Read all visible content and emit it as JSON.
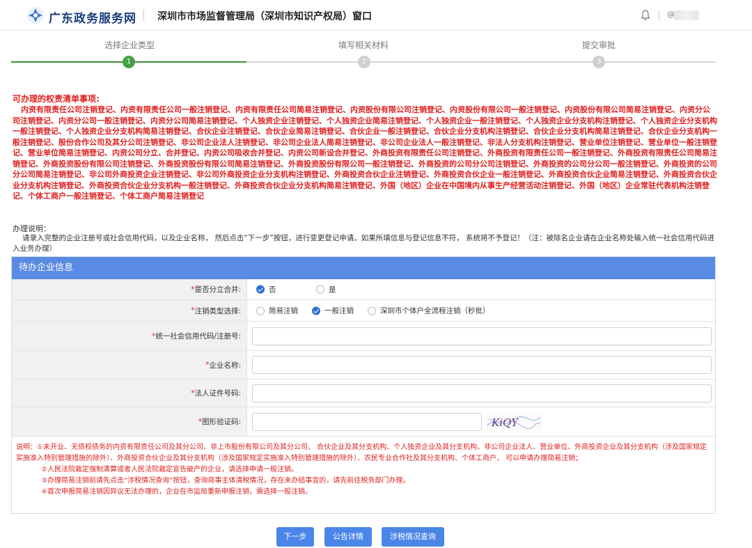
{
  "header": {
    "site_name": "广东政务服务网",
    "window_title": "深圳市市场监督管理局（深圳市知识产权局）窗口",
    "user_icon": "@"
  },
  "steps": [
    {
      "label": "选择企业类型",
      "number": "1",
      "active": true
    },
    {
      "label": "填写相关材料",
      "number": "2",
      "active": false
    },
    {
      "label": "提交审批",
      "number": "3",
      "active": false
    }
  ],
  "rights": {
    "title": "可办理的权责清单事项:",
    "text": "内资有限责任公司注销登记、内资有限责任公司一般注销登记、内资有限责任公司简易注销登记、内资股份有限公司注销登记、内资股份有限公司一般注销登记、内资股份有限公司简易注销登记、内资分公司注销登记、内资分公司一般注销登记、内资分公司简易注销登记、个人独资企业注销登记、个人独资企业简易注销登记、个人独资企业一般注销登记、个人独资企业分支机构注销登记、个人独资企业分支机构一般注销登记、个人独资企业分支机构简易注销登记、合伙企业注销登记、合伙企业简易注销登记、合伙企业一般注销登记、合伙企业分支机构注销登记、合伙企业分支机构简易注销登记、合伙企业分支机构一般注销登记、股份合作公司及其分公司注销登记、非公司企业法人注销登记、非公司企业法人简易注销登记、非公司企业法人一般注销登记、非法人分支机构注销登记、营业单位注销登记、营业单位一般注销登记、营业单位简易注销登记、内资公司分立、合并登记、内资公司吸收合并登记、内资公司新设合并登记、外商投资有限责任公司注销登记、外商投资有限责任公司一般注销登记、外商投资有限责任公司简易注销登记、外商投资股份有限公司注销登记、外商投资股份有限公司简易注销登记、外商投资股份有限公司一般注销登记、外商投资的公司分公司注销登记、外商投资的公司分公司一般注销登记、外商投资的公司分公司简易注销登记、非公司外商投资企业注销登记、非公司外商投资企业分支机构注销登记、外商投资合伙企业注销登记、外商投资合伙企业一般注销登记、外商投资合伙企业简易注销登记、外商投资合伙企业分支机构注销登记、外商投资合伙企业分支机构一般注销登记、外商投资合伙企业分支机构简易注销登记、外国（地区）企业在中国境内从事生产经营活动注销登记、外国（地区）企业常驻代表机构注销登记、个体工商户一般注销登记、个体工商户简易注销登记"
  },
  "note": {
    "title": "办理说明：",
    "text": "请录入完整的企业注册号或社会信用代码，以及企业名称， 然后点击“下一步”按钮，进行变更登记申请。如果所填信息与登记信息不符， 系统将不予登记！（注：被除名企业请在企业名称处输入统一社会信用代码进入业务办理）"
  },
  "form": {
    "title": "待办企业信息",
    "split_merge": {
      "label": "是否分立合并:",
      "options": [
        "否",
        "是"
      ],
      "selected": "否"
    },
    "cancel_type": {
      "label": "注销类型选择:",
      "options": [
        "简易注销",
        "一般注销",
        "深圳市个体户全流程注销（秒批）"
      ],
      "selected": "一般注销"
    },
    "credit_code": {
      "label": "统一社会信用代码/注册号:",
      "value": ""
    },
    "company_name": {
      "label": "企业名称:",
      "value": ""
    },
    "legal_id": {
      "label": "法人证件号码:",
      "value": ""
    },
    "captcha": {
      "label": "图形验证码:",
      "value": "",
      "image_text": "KiQY"
    },
    "explain": [
      "说明：①未开业、无债权债务的内资有限责任公司及其分公司、非上市股份有限公司及其分公司、 合伙企业及其分支机构、个人独资企业及其分支机构、非公司企业法人、营业单位、外商投资企业及其分支机构（涉及国家规定实施准入特别管理措施的除外）、外商投资合伙企业及其分支机构（涉及国家规定实施准入特别管理措施的除外）、农民专业合作社及其分支机构、个体工商户， 可以申请办理简易注销；",
      "②人民法院裁定强制清算或者人民法院裁定宣告破产的企业，请选择申请一般注销。",
      "③办理简易注销前请先点击“涉税情况查询”按钮，查询商事主体清税情况，存在未办结事宜的，请先前往税务部门办理。",
      "④首次申报简易注销因异议无法办理的，企业在市监局重新申报注销，需选择一般注销。"
    ]
  },
  "buttons": {
    "next": "下一步",
    "notice": "公告详情",
    "tax": "涉税情况查询"
  },
  "colors": {
    "brand": "#1a3d7c",
    "accent": "#4a86e8",
    "alert": "#e02020",
    "step_active": "#46a046"
  }
}
